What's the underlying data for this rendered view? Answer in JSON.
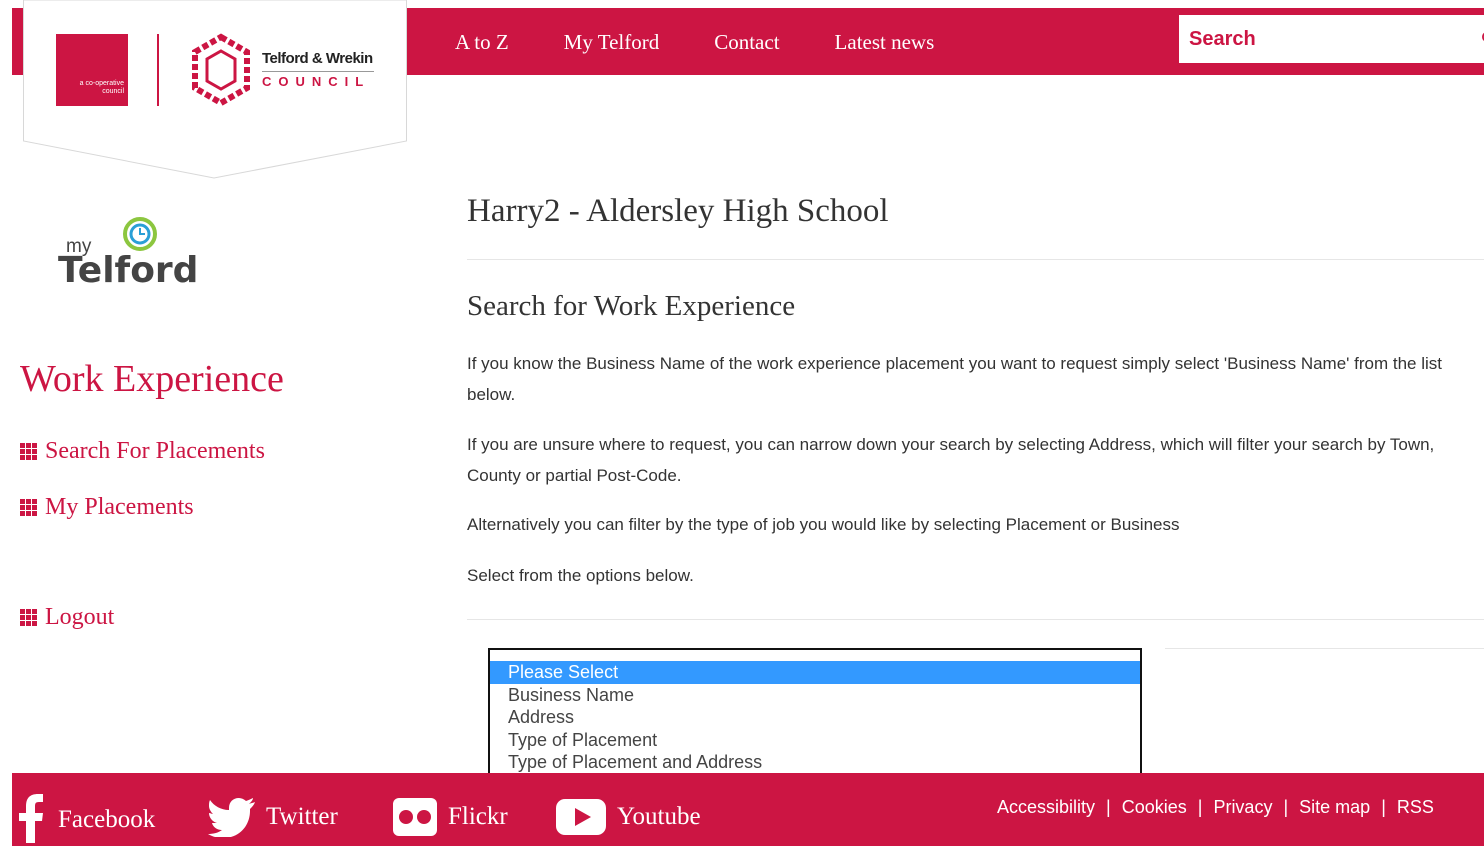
{
  "header": {
    "nav": [
      "A to Z",
      "My Telford",
      "Contact",
      "Latest news"
    ],
    "search_placeholder": "Search"
  },
  "logo": {
    "coop_text": "a co-operative council",
    "council_name": "Telford & Wrekin",
    "council_word": "COUNCIL"
  },
  "mytelford": {
    "my": "my",
    "telford": "Telford"
  },
  "sidebar": {
    "title": "Work Experience",
    "links": [
      "Search For Placements",
      "My Placements",
      "Logout"
    ]
  },
  "main": {
    "page_title": "Harry2 - Aldersley High School",
    "section_title": "Search for Work Experience",
    "paragraphs": [
      "If you know the Business Name of the work experience placement you want to request simply select 'Business Name' from the list below.",
      "If you are unsure where to request, you can narrow down your search by selecting Address, which will filter your search by Town, County or partial Post-Code.",
      "Alternatively you can filter by the type of job you would like by selecting Placement or Business",
      "Select from the options below."
    ],
    "select_options": [
      "Please Select",
      "Business Name",
      "Address",
      "Type of Placement",
      "Type of Placement and Address"
    ],
    "selected_index": 0
  },
  "footer": {
    "social": [
      "Facebook",
      "Twitter",
      "Flickr",
      "Youtube"
    ],
    "links": [
      "Accessibility",
      "Cookies",
      "Privacy",
      "Site map",
      "RSS"
    ]
  },
  "colors": {
    "brand": "#cc1543",
    "selection": "#3399ff"
  }
}
